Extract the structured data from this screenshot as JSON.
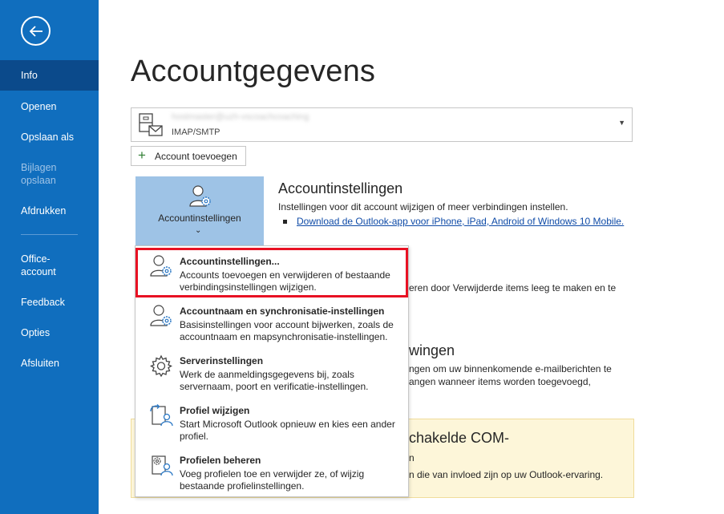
{
  "sidebar": {
    "items": [
      {
        "label": "Info",
        "active": true
      },
      {
        "label": "Openen"
      },
      {
        "label": "Opslaan als"
      },
      {
        "label": "Bijlagen opslaan",
        "disabled": true
      },
      {
        "label": "Afdrukken"
      },
      {
        "label": "Office-account"
      },
      {
        "label": "Feedback"
      },
      {
        "label": "Opties"
      },
      {
        "label": "Afsluiten"
      }
    ]
  },
  "main": {
    "title": "Accountgegevens",
    "account": {
      "email": "hostmaster@uzh-vscoachcoaching",
      "type": "IMAP/SMTP"
    },
    "add_account_label": "Account toevoegen",
    "tile_label": "Accountinstellingen",
    "settings_section": {
      "title": "Accountinstellingen",
      "description": "Instellingen voor dit account wijzigen of meer verbindingen instellen.",
      "link": "Download de Outlook-app voor iPhone, iPad, Android of Windows 10 Mobile."
    },
    "cleanup_text": "eren door Verwijderde items leeg te maken en te",
    "rules_section": {
      "title_fragment": "wingen",
      "line1": "ngen om uw binnenkomende e-mailberichten te",
      "line2": "angen wanneer items worden toegevoegd,"
    },
    "com_section": {
      "title_fragment": "chakelde COM-",
      "line_fragment": "n",
      "desc_fragment": "n die van invloed zijn op uw Outlook-ervaring."
    }
  },
  "menu": {
    "items": [
      {
        "title": "Accountinstellingen...",
        "description": "Accounts toevoegen en verwijderen of bestaande verbindingsinstellingen wijzigen."
      },
      {
        "title": "Accountnaam en synchronisatie-instellingen",
        "description": "Basisinstellingen voor account bijwerken, zoals de accountnaam en mapsynchronisatie-instellingen."
      },
      {
        "title": "Serverinstellingen",
        "description": "Werk de aanmeldingsgegevens bij, zoals servernaam, poort en verificatie-instellingen."
      },
      {
        "title": "Profiel wijzigen",
        "description": "Start  Microsoft Outlook opnieuw en kies een ander profiel."
      },
      {
        "title": "Profielen beheren",
        "description": "Voeg profielen toe en verwijder ze, of wijzig bestaande profielinstellingen."
      }
    ]
  },
  "colors": {
    "sidebar": "#106ebe",
    "sidebar_active": "#0b4a8b",
    "tile": "#9ec3e6",
    "highlight": "#e81123",
    "link": "#0f4ba7"
  }
}
